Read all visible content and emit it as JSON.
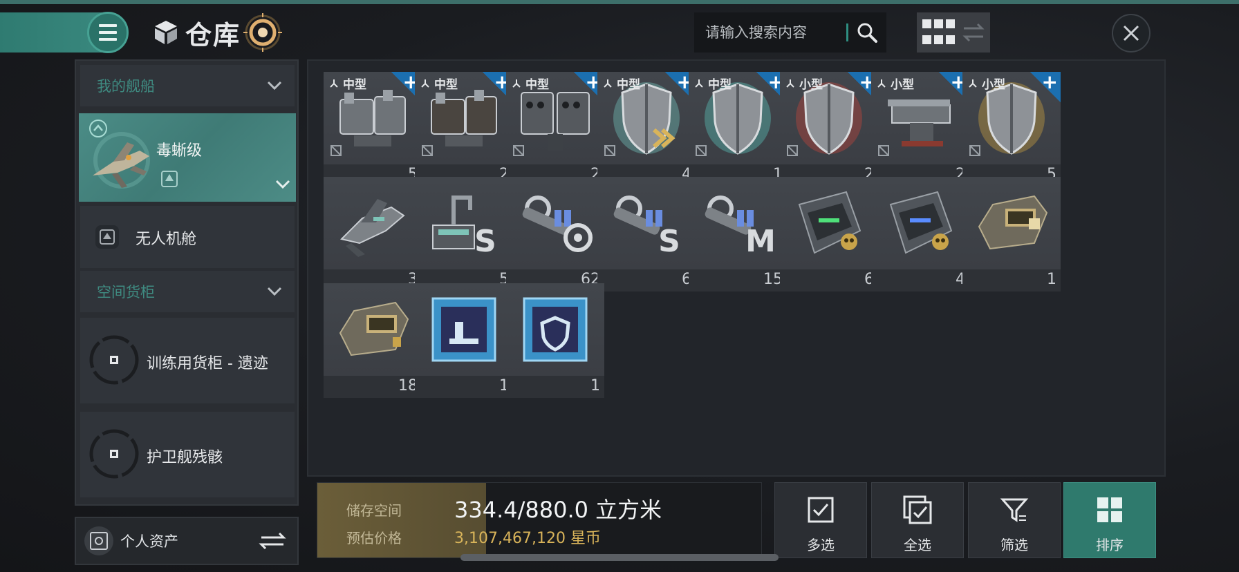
{
  "header": {
    "title": "仓库",
    "search_placeholder": "请输入搜索内容"
  },
  "sidebar": {
    "section_my_ships": "我的舰船",
    "ship_name": "毒蜥级",
    "drone_bay": "无人机舱",
    "section_space_containers": "空间货柜",
    "container_1": "训练用货柜 - 遗迹",
    "container_2": "护卫舰残骸"
  },
  "personal_assets": "个人资产",
  "items": [
    {
      "size_label": "中型",
      "count": "5",
      "icon": "triple-turret-module",
      "has_plus": true
    },
    {
      "size_label": "中型",
      "count": "2",
      "icon": "dark-turret-module",
      "has_plus": true
    },
    {
      "size_label": "中型",
      "count": "2",
      "icon": "missile-launcher-module",
      "has_plus": true
    },
    {
      "size_label": "中型",
      "count": "4",
      "icon": "shield-booster-gold-chevrons",
      "has_plus": true
    },
    {
      "size_label": "中型",
      "count": "1",
      "icon": "shield-teal-glow",
      "has_plus": true
    },
    {
      "size_label": "小型",
      "count": "2",
      "icon": "shield-red-glow",
      "has_plus": true
    },
    {
      "size_label": "小型",
      "count": "2",
      "icon": "small-turret-module",
      "has_plus": true
    },
    {
      "size_label": "小型",
      "count": "5",
      "icon": "shield-gold-glow",
      "has_plus": true
    },
    {
      "size_label": "",
      "count": "3",
      "icon": "drone-cluster",
      "has_plus": false
    },
    {
      "size_label": "",
      "count": "5",
      "icon": "small-ammo-s",
      "has_plus": false
    },
    {
      "size_label": "",
      "count": "62",
      "icon": "crystal-ammo-c",
      "has_plus": false
    },
    {
      "size_label": "",
      "count": "6",
      "icon": "crystal-ammo-s",
      "has_plus": false
    },
    {
      "size_label": "",
      "count": "15",
      "icon": "crystal-ammo-m",
      "has_plus": false
    },
    {
      "size_label": "",
      "count": "6",
      "icon": "skull-module-green",
      "has_plus": false
    },
    {
      "size_label": "",
      "count": "4",
      "icon": "skull-module-blue",
      "has_plus": false
    },
    {
      "size_label": "",
      "count": "1",
      "icon": "gold-cargo-module",
      "has_plus": false
    },
    {
      "size_label": "",
      "count": "18",
      "icon": "gold-engine-module",
      "has_plus": false
    },
    {
      "size_label": "",
      "count": "1",
      "icon": "blue-chip-blueprint",
      "has_plus": false
    },
    {
      "size_label": "",
      "count": "1",
      "icon": "blue-chip-shield",
      "has_plus": false
    }
  ],
  "storage": {
    "space_label": "储存空间",
    "space_value": "334.4/880.0 立方米",
    "space_used": 334.4,
    "space_total": 880.0,
    "price_label": "预估价格",
    "price_value": "3,107,467,120 星币"
  },
  "actions": {
    "multi_select": "多选",
    "select_all": "全选",
    "filter": "筛选",
    "sort": "排序"
  },
  "colors": {
    "accent_teal": "#2f7a6d",
    "plus_blue": "#1b6fb0",
    "price_gold": "#d9b45a"
  }
}
